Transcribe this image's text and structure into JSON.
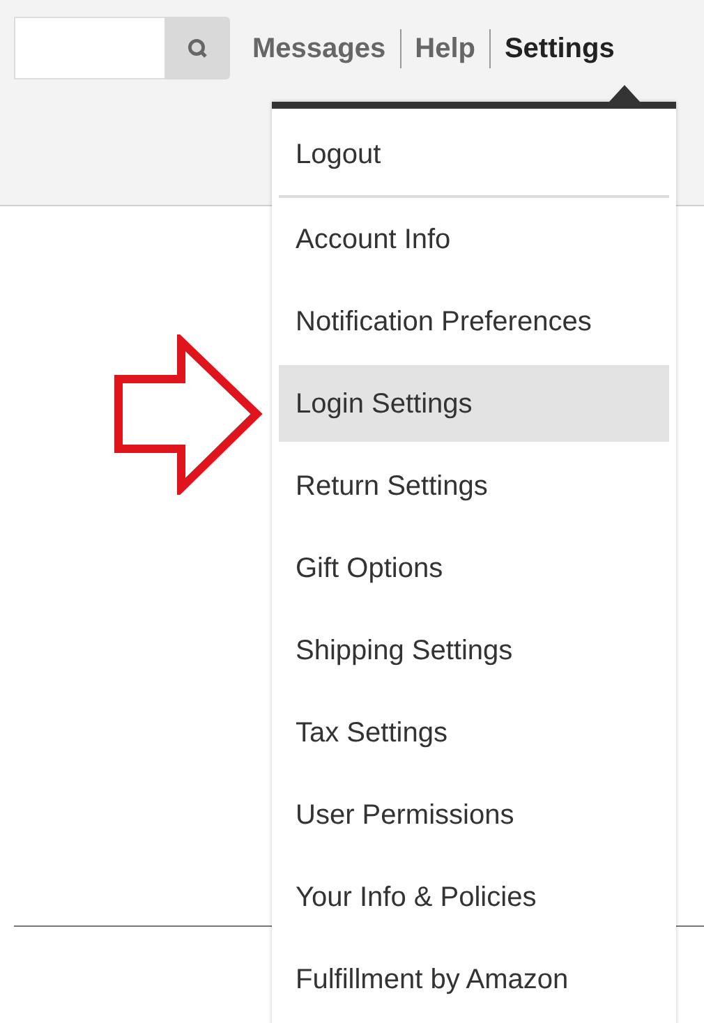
{
  "nav": [
    {
      "label": "Messages",
      "selected": false
    },
    {
      "label": "Help",
      "selected": false
    },
    {
      "label": "Settings",
      "selected": true
    }
  ],
  "menu": {
    "items": [
      {
        "label": "Logout",
        "selected": false,
        "divider_after": true
      },
      {
        "label": "Account Info",
        "selected": false,
        "divider_after": false
      },
      {
        "label": "Notification Preferences",
        "selected": false,
        "divider_after": false
      },
      {
        "label": "Login Settings",
        "selected": true,
        "divider_after": false
      },
      {
        "label": "Return Settings",
        "selected": false,
        "divider_after": false
      },
      {
        "label": "Gift Options",
        "selected": false,
        "divider_after": false
      },
      {
        "label": "Shipping Settings",
        "selected": false,
        "divider_after": false
      },
      {
        "label": "Tax Settings",
        "selected": false,
        "divider_after": false
      },
      {
        "label": "User Permissions",
        "selected": false,
        "divider_after": false
      },
      {
        "label": "Your Info & Policies",
        "selected": false,
        "divider_after": false
      },
      {
        "label": "Fulfillment by Amazon",
        "selected": false,
        "divider_after": false
      }
    ]
  }
}
